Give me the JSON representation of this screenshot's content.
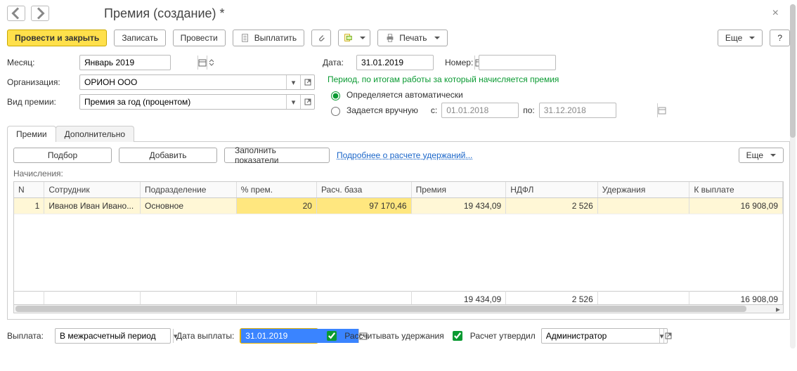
{
  "header": {
    "title": "Премия (создание) *"
  },
  "toolbar": {
    "post_close": "Провести и закрыть",
    "save": "Записать",
    "post": "Провести",
    "pay": "Выплатить",
    "print": "Печать",
    "more": "Еще",
    "help": "?"
  },
  "fields": {
    "month_label": "Месяц:",
    "month_value": "Январь 2019",
    "org_label": "Организация:",
    "org_value": "ОРИОН ООО",
    "type_label": "Вид премии:",
    "type_value": "Премия за год (процентом)",
    "date_label": "Дата:",
    "date_value": "31.01.2019",
    "number_label": "Номер:",
    "number_value": ""
  },
  "period": {
    "title": "Период, по итогам работы за который начисляется премия",
    "auto_label": "Определяется автоматически",
    "manual_label": "Задается вручную",
    "from_label": "с:",
    "from_value": "01.01.2018",
    "to_label": "по:",
    "to_value": "31.12.2018"
  },
  "tabs": {
    "bonuses": "Премии",
    "additional": "Дополнительно"
  },
  "panel": {
    "pick": "Подбор",
    "add": "Добавить",
    "fill": "Заполнить показатели",
    "link": "Подробнее о расчете удержаний...",
    "more": "Еще",
    "section_label": "Начисления:"
  },
  "grid": {
    "columns": [
      "N",
      "Сотрудник",
      "Подразделение",
      "% прем.",
      "Расч. база",
      "Премия",
      "НДФЛ",
      "Удержания",
      "К выплате"
    ],
    "rows": [
      {
        "n": "1",
        "employee": "Иванов Иван Ивано...",
        "dept": "Основное",
        "percent": "20",
        "base": "97 170,46",
        "bonus": "19 434,09",
        "ndfl": "2 526",
        "withhold": "",
        "pay": "16 908,09"
      }
    ],
    "totals": {
      "bonus": "19 434,09",
      "ndfl": "2 526",
      "withhold": "",
      "pay": "16 908,09"
    }
  },
  "footer": {
    "payout_label": "Выплата:",
    "payout_value": "В межрасчетный период",
    "paydate_label": "Дата выплаты:",
    "paydate_value": "31.01.2019",
    "calc_withhold": "Рассчитывать удержания",
    "approved": "Расчет утвердил",
    "approver": "Администратор"
  }
}
